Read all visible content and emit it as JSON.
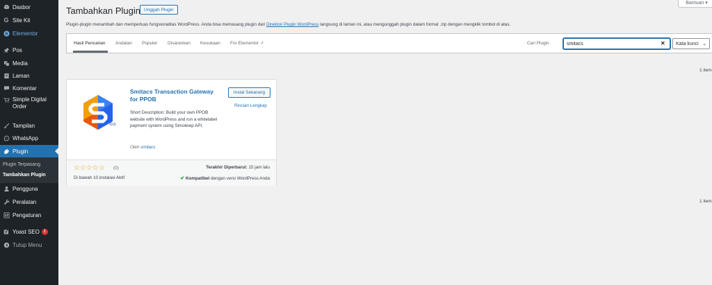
{
  "sidebar": {
    "items": {
      "dasbor": "Dasbor",
      "sitekit": "Site Kit",
      "elementor": "Elementor",
      "pos": "Pos",
      "media": "Media",
      "laman": "Laman",
      "komentar": "Komentar",
      "simple_digital_order": "Simple Digital Order",
      "tampilan": "Tampilan",
      "whatsapp": "WhatsApp",
      "plugin": "Plugin",
      "pengguna": "Pengguna",
      "peralatan": "Peralatan",
      "pengaturan": "Pengaturan",
      "yoast": "Yoast SEO",
      "yoast_badge": "1",
      "tutup_menu": "Tutup Menu"
    },
    "submenu": {
      "installed": "Plugin Terpasang",
      "add_new": "Tambahkan Plugin"
    }
  },
  "help_button": "Bantuan ▾",
  "header": {
    "title": "Tambahkan Plugin",
    "upload_button": "Unggah Plugin",
    "description_before": "Plugin-plugin menambah dan memperluas fungsionalitas WordPress. Anda bisa memasang plugin dari ",
    "description_link": "Direktori Plugin WordPress",
    "description_after": " langsung di laman ini, atau mengunggah plugin dalam format .zip dengan mengklik tombol di atas."
  },
  "filter": {
    "tabs": {
      "search_results": "Hasil Pencarian",
      "featured": "Andalan",
      "popular": "Populer",
      "recommended": "Disarankan",
      "favorites": "Kesukaan",
      "for_elementor": "For Elementor"
    },
    "search_label": "Cari Plugin",
    "search_value": "smitacs",
    "search_type": "Kata kunci"
  },
  "result_count": "1 item",
  "plugin": {
    "name": "Smitacs Transaction Gateway for PPOB",
    "install_button": "Instal Sekarang",
    "details_link": "Rincian Lengkap",
    "description": "Short Description: Build your own PPOB website with WordPress and run a whitelabel payment system using Simolewp API.",
    "author_prefix": "Oleh ",
    "author": "smitacs",
    "stars": "☆☆☆☆☆",
    "rating_count": "(0)",
    "installs": "Di bawah 10 instalasi Aktif",
    "last_updated_label": "Terakhir Diperbarui:",
    "last_updated_value": " 15 jam lalu",
    "compat_label": "Kompatibel",
    "compat_text": " dengan versi WordPress Anda",
    "rating": 0
  },
  "colors": {
    "sidebar_bg": "#1d2327",
    "accent": "#2271b1",
    "star": "#dba617",
    "compat_check": "#00a32a"
  }
}
